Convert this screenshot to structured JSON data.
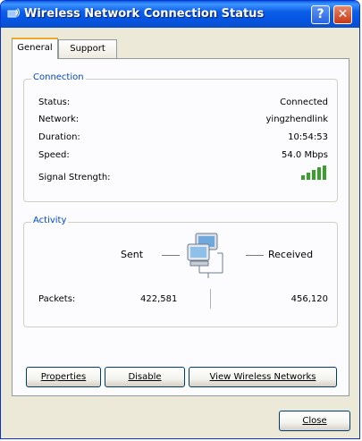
{
  "window": {
    "title": "Wireless Network Connection Status",
    "help_glyph": "?",
    "close_glyph": "✕"
  },
  "tabs": [
    {
      "label": "General",
      "active": true
    },
    {
      "label": "Support",
      "active": false
    }
  ],
  "connection": {
    "legend": "Connection",
    "rows": [
      {
        "label": "Status:",
        "value": "Connected"
      },
      {
        "label": "Network:",
        "value": "yingzhendlink"
      },
      {
        "label": "Duration:",
        "value": "10:54:53"
      },
      {
        "label": "Speed:",
        "value": "54.0 Mbps"
      }
    ],
    "signal_label": "Signal Strength:",
    "signal_bars": 5
  },
  "activity": {
    "legend": "Activity",
    "sent_label": "Sent",
    "received_label": "Received",
    "packets_label": "Packets:",
    "packets_sent": "422,581",
    "packets_received": "456,120"
  },
  "buttons": {
    "properties": "Properties",
    "disable": "Disable",
    "view_networks": "View Wireless Networks",
    "close": "Close"
  },
  "colors": {
    "titlebar": "#0554e3",
    "legend_text": "#0046d5",
    "signal_bar": "#38a02b"
  },
  "icons": {
    "title": "wireless-network-icon",
    "activity": "network-computers-icon"
  }
}
